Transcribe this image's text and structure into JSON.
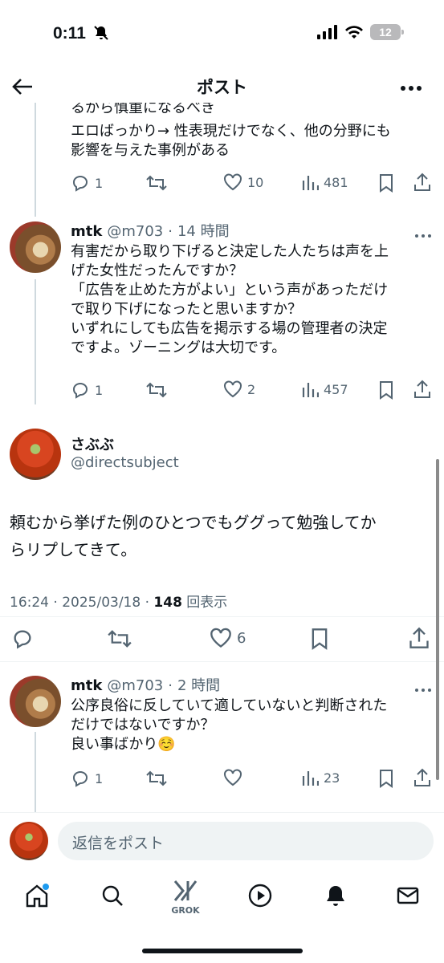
{
  "status_bar": {
    "time": "0:11",
    "battery": "12"
  },
  "nav": {
    "title": "ポスト"
  },
  "top_post": {
    "text_partial": "るから慎重になるべき",
    "text": "エロばっかり→ 性表現だけでなく、他の分野にも\n影響を与えた事例がある",
    "replies": "1",
    "likes": "10",
    "views": "481"
  },
  "reply1": {
    "name": "mtk",
    "handle": "@m703",
    "time": "14 時間",
    "text": "有害だから取り下げると決定した人たちは声を上\nげた女性だったんですか？\n「広告を止めた方がよい」という声があっただけ\nで取り下げになったと思いますか？\nいずれにしても広告を掲示する場の管理者の決定\nですよ。ゾーニングは大切です。",
    "replies": "1",
    "likes": "2",
    "views": "457"
  },
  "main_post": {
    "name": "さぶぶ",
    "handle": "@directsubject",
    "text": "頼むから挙げた例のひとつでもググって勉強してか\nらリプしてきて。",
    "timestamp": "16:24 · 2025/03/18 · ",
    "view_count": "148",
    "view_label": " 回表示",
    "likes": "6"
  },
  "reply2": {
    "name": "mtk",
    "handle": "@m703",
    "time": "2 時間",
    "text": "公序良俗に反していて適していないと判断された\nだけではないですか？\n良い事ばかり☺️",
    "replies": "1",
    "views": "23"
  },
  "composer": {
    "placeholder": "返信をポスト"
  },
  "tabbar": {
    "grok_label": "GROK"
  },
  "colors": {
    "secondary": "#536471",
    "accent": "#1d9bf0"
  }
}
